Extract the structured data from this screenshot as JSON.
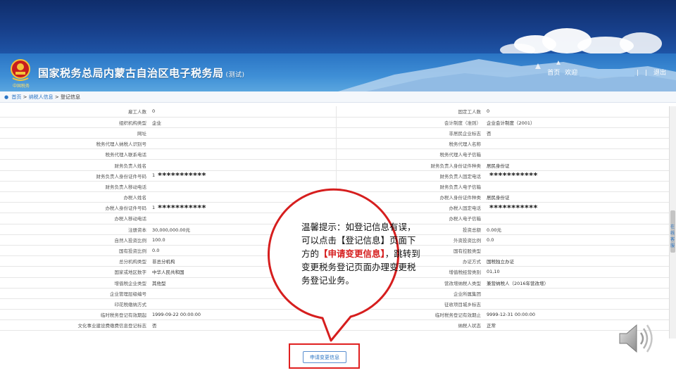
{
  "header": {
    "title": "国家税务总局内蒙古自治区电子税务局",
    "title_suffix": "(测试)",
    "emblem_caption": "中国税务",
    "home_link": "首页",
    "welcome_text": "欢迎",
    "logout": "退出",
    "separator_left": "|",
    "separator_right": "|"
  },
  "breadcrumb": {
    "home": "首页",
    "level1": "纳税人信息",
    "current": "登记信息",
    "separator": ">"
  },
  "rows": [
    {
      "l1": "雇工人数",
      "v1": "0",
      "l2": "固定工人数",
      "v2": "0"
    },
    {
      "l1": "组织机构类型",
      "v1": "企业",
      "l2": "会计制度（准则）",
      "v2": "企业会计制度（2001）"
    },
    {
      "l1": "网址",
      "v1": "",
      "l2": "非居民企业标志",
      "v2": "否"
    },
    {
      "l1": "税务代理人纳税人识别号",
      "v1": "",
      "l2": "税务代理人名称",
      "v2": ""
    },
    {
      "l1": "税务代理人联系电话",
      "v1": "",
      "l2": "税务代理人电子信箱",
      "v2": ""
    },
    {
      "l1": "财务负责人姓名",
      "v1": "",
      "l2": "财务负责人身份证件种类",
      "v2": "居民身份证"
    },
    {
      "l1": "财务负责人身份证件号码",
      "v1": "1",
      "v1_mask": "***********",
      "l2": "财务负责人固定电话",
      "v2": "",
      "v2_mask": "***********"
    },
    {
      "l1": "财务负责人移动电话",
      "v1": "",
      "l2": "财务负责人电子信箱",
      "v2": ""
    },
    {
      "l1": "办税人姓名",
      "v1": "",
      "l2": "办税人身份证件种类",
      "v2": "居民身份证"
    },
    {
      "l1": "办税人身份证件号码",
      "v1": "1",
      "v1_mask": "***********",
      "l2": "办税人固定电话",
      "v2": "",
      "v2_mask": "***********"
    },
    {
      "l1": "办税人移动电话",
      "v1": "",
      "l2": "办税人电子信箱",
      "v2": ""
    },
    {
      "l1": "注册资本",
      "v1": "30,000,000.00元",
      "l2": "投资总额",
      "v2": "0.00元"
    },
    {
      "l1": "自然人投资比例",
      "v1": "100.0",
      "l2": "外资投资比例",
      "v2": "0.0"
    },
    {
      "l1": "国有投资比例",
      "v1": "0.0",
      "l2": "国有控股类型",
      "v2": ""
    },
    {
      "l1": "总分机构类型",
      "v1": "非总分机构",
      "l2": "办证方式",
      "v2": "国税独立办证"
    },
    {
      "l1": "国家或地区数字",
      "v1": "中华人民共和国",
      "l2": "增值税经营类别",
      "v2": "01,10"
    },
    {
      "l1": "增值税企业类型",
      "v1": "其他型",
      "l2": "营改增纳税人类型",
      "v2": "兼营纳税人（2016年营改增）"
    },
    {
      "l1": "企业管理层级编号",
      "v1": "",
      "l2": "企业所属集团",
      "v2": ""
    },
    {
      "l1": "印花税缴纳方式",
      "v1": "",
      "l2": "征收项目城乡标志",
      "v2": ""
    },
    {
      "l1": "临时税务登记有效期起",
      "v1": "1999-09-22 00:00:00",
      "l2": "临时税务登记有效期止",
      "v2": "9999-12-31 00:00:00"
    },
    {
      "l1": "文化事业建设费缴费信息登记标志",
      "v1": "否",
      "l2": "纳税人状态",
      "v2": "正常"
    }
  ],
  "apply_button": "申请变更信息",
  "callout": {
    "part1": "温馨提示：如登记信息有误，可以点击【登记信息】页面下方的",
    "highlight": "【申请变更信息】",
    "part2": "，跳转到变更税务登记页面办理变更税务登记业务。"
  },
  "side_tab": "在线客服",
  "colors": {
    "top_band": "#173f8a",
    "header": "#3f8fd6",
    "callout_border": "#d61e1e",
    "highlight_text": "#d61e1e",
    "link": "#2a74c4"
  },
  "icons": {
    "emblem": "tax-emblem-icon",
    "pin": "location-pin-icon",
    "speaker": "speaker-icon"
  }
}
